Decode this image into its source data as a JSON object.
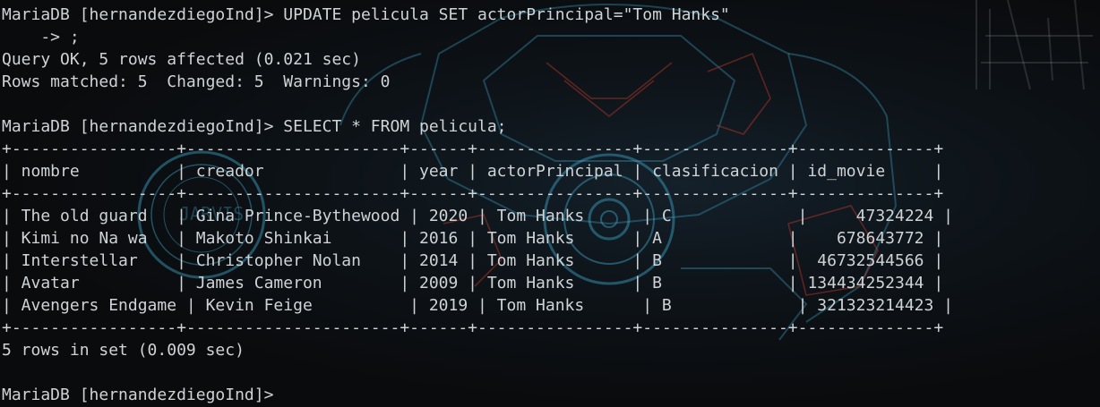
{
  "lines": [
    "MariaDB [hernandezdiegoInd]> UPDATE pelicula SET actorPrincipal=\"Tom Hanks\"",
    "    -> ;",
    "Query OK, 5 rows affected (0.021 sec)",
    "Rows matched: 5  Changed: 5  Warnings: 0",
    "",
    "MariaDB [hernandezdiegoInd]> SELECT * FROM pelicula;",
    "+-----------------+----------------------+------+----------------+---------------+--------------+",
    "| nombre          | creador              | year | actorPrincipal | clasificacion | id_movie     |",
    "+-----------------+----------------------+------+----------------+---------------+--------------+",
    "| The old guard   | Gina Prince-Bythewood | 2020 | Tom Hanks      | C             |     47324224 |",
    "| Kimi no Na wa   | Makoto Shinkai       | 2016 | Tom Hanks      | A             |    678643772 |",
    "| Interstellar    | Christopher Nolan    | 2014 | Tom Hanks      | B             |  46732544566 |",
    "| Avatar          | James Cameron        | 2009 | Tom Hanks      | B             | 134434252344 |",
    "| Avengers Endgame | Kevin Feige          | 2019 | Tom Hanks      | B             | 321323214423 |",
    "+-----------------+----------------------+------+----------------+---------------+--------------+",
    "5 rows in set (0.009 sec)",
    "",
    "MariaDB [hernandezdiegoInd]>"
  ],
  "bg_text": "JARVIS",
  "colors": {
    "text": "#cfd3d6",
    "art_cyan": "#3fa6c8",
    "art_red": "#c0392b"
  }
}
